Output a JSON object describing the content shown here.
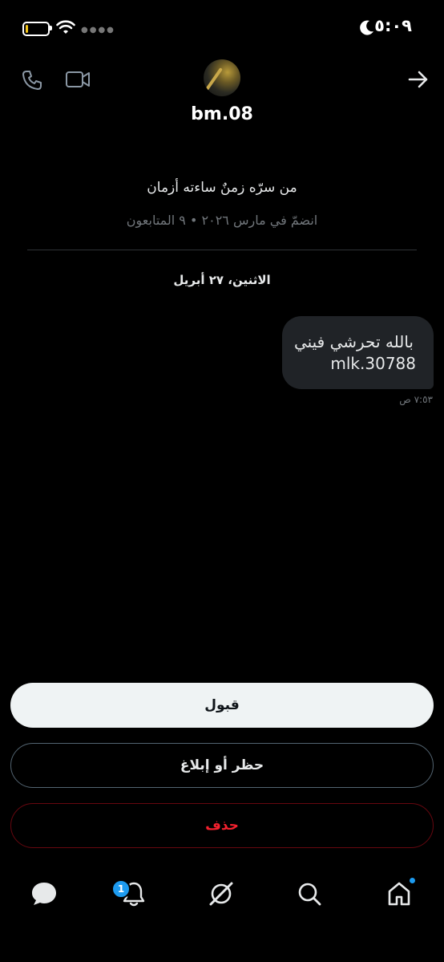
{
  "status_bar": {
    "time": "٥:٠٩"
  },
  "header": {
    "username": "bm.08",
    "icons": [
      "phone-icon",
      "video-icon",
      "back-arrow-icon"
    ]
  },
  "profile": {
    "bio": "من سرّه زمنٌ ساءته أزمان",
    "meta": "انضمّ في مارس ٢٠٢٦ • ٩ المتابعون"
  },
  "conversation": {
    "date": "الاثنين، ٢٧ أبريل",
    "messages": [
      {
        "line1": "بالله تحرشي فيني",
        "line2": "mlk.30788",
        "time": "٧:٥٣ ص"
      }
    ]
  },
  "actions": {
    "accept": "قبول",
    "block_report": "حظر أو إبلاغ",
    "delete": "حذف"
  },
  "bottom_nav": {
    "notifications_badge": "1",
    "items": [
      "messages-icon",
      "notifications-icon",
      "grok-icon",
      "search-icon",
      "home-icon"
    ]
  },
  "colors": {
    "background": "#000000",
    "accent": "#1d9bf0",
    "danger": "#f4212e",
    "bubble": "#202327"
  }
}
